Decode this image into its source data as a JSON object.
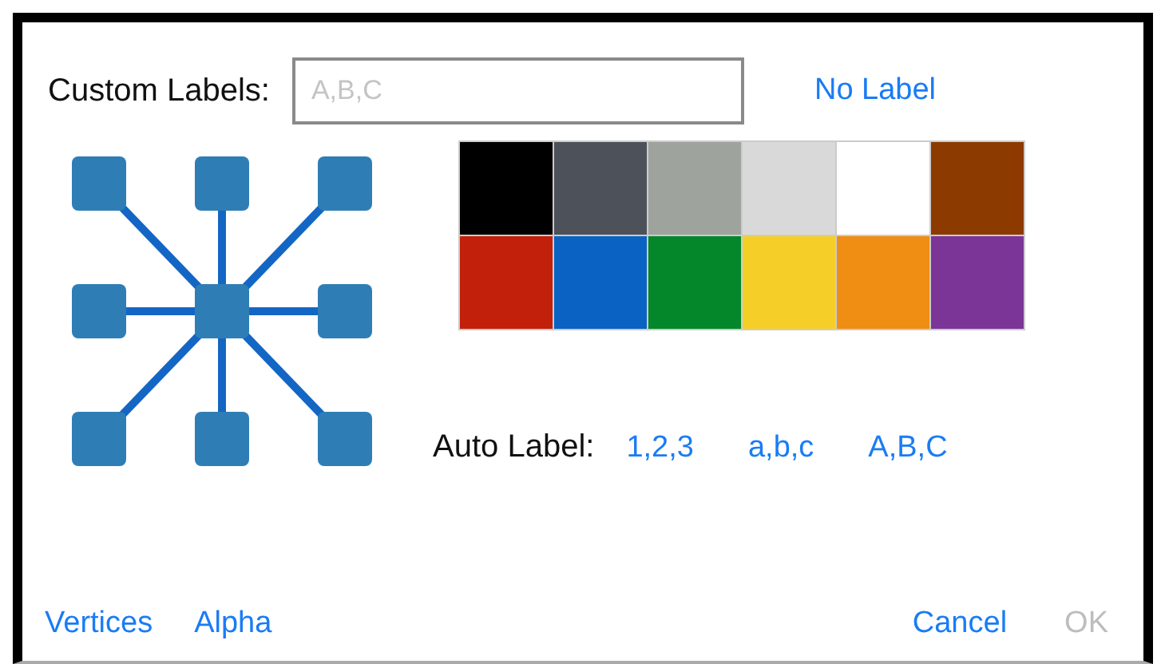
{
  "custom_labels": {
    "label": "Custom Labels:",
    "placeholder": "A,B,C"
  },
  "no_label_button": "No Label",
  "swatches": [
    {
      "color": "#000000"
    },
    {
      "color": "#4d5159"
    },
    {
      "color": "#9ea39e"
    },
    {
      "color": "#d9d9d9"
    },
    {
      "color": "#ffffff"
    },
    {
      "color": "#8c3a00"
    },
    {
      "color": "#c2200b"
    },
    {
      "color": "#0a62c2"
    },
    {
      "color": "#04862a"
    },
    {
      "color": "#f5cf28"
    },
    {
      "color": "#ef8e12"
    },
    {
      "color": "#7a3597"
    }
  ],
  "auto_label": {
    "label": "Auto Label:",
    "options": [
      "1,2,3",
      "a,b,c",
      "A,B,C"
    ]
  },
  "footer": {
    "left": [
      "Vertices",
      "Alpha"
    ],
    "cancel": "Cancel",
    "ok": {
      "label": "OK",
      "disabled": true
    }
  }
}
